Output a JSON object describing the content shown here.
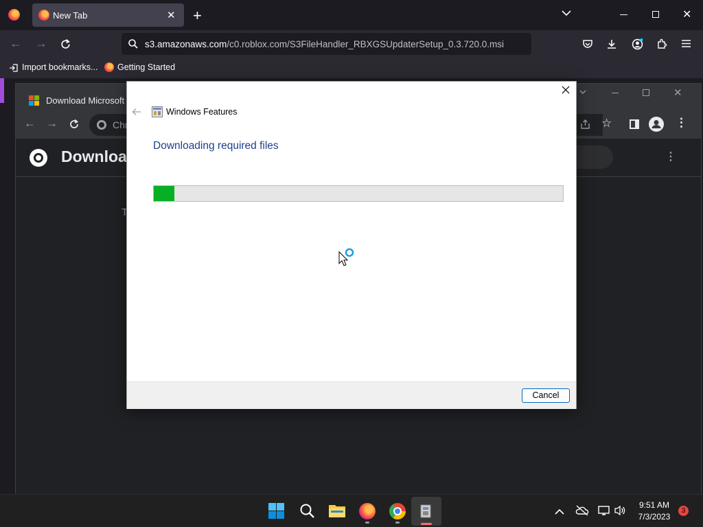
{
  "firefox": {
    "tab": {
      "title": "New Tab"
    },
    "url": {
      "host": "s3.amazonaws.com",
      "path": "/c0.roblox.com/S3FileHandler_RBXGSUpdaterSetup_0.3.720.0.msi"
    },
    "bookmarks": [
      {
        "label": "Import bookmarks..."
      },
      {
        "label": "Getting Started"
      }
    ]
  },
  "chrome_window": {
    "tab_title": "Download Microsoft .N",
    "omnibox_prefix": "Chr",
    "page_title": "Download",
    "page_text_fragment": "T"
  },
  "dialog": {
    "title": "Windows Features",
    "heading": "Downloading required files",
    "progress": 0.05,
    "cancel_label": "Cancel"
  },
  "taskbar": {
    "time": "9:51 AM",
    "date": "7/3/2023",
    "notification_count": "3"
  },
  "colors": {
    "progress_green": "#06b025",
    "heading_blue": "#1e3f8c",
    "accent": "#0067c0"
  }
}
